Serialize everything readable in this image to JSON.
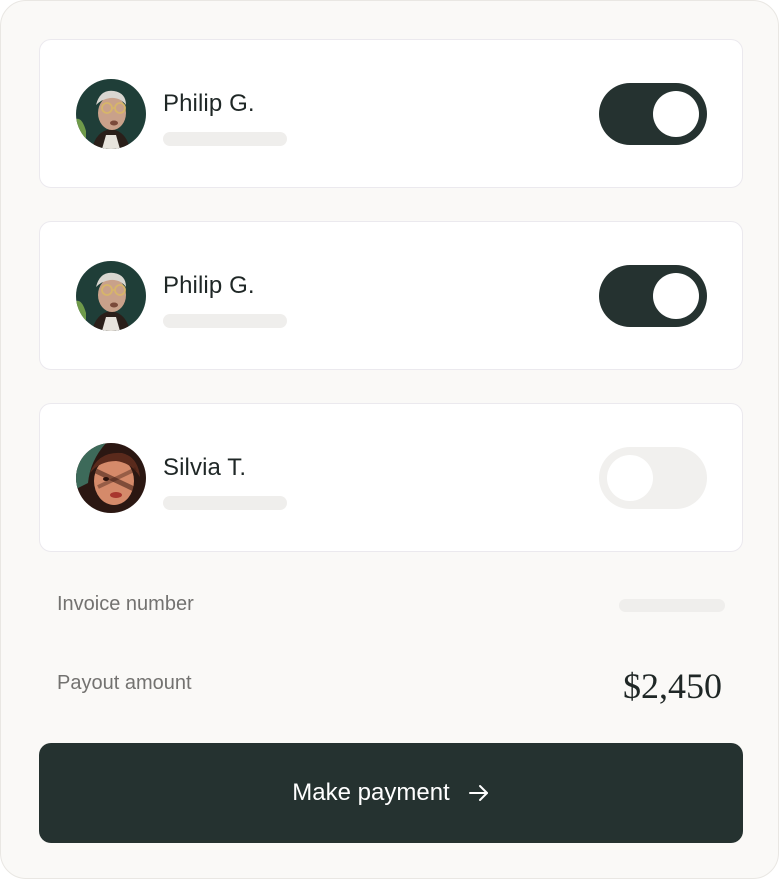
{
  "payees": [
    {
      "name": "Philip G.",
      "toggle_on": true,
      "avatar": "man-glasses-avatar"
    },
    {
      "name": "Philip G.",
      "toggle_on": true,
      "avatar": "man-glasses-avatar"
    },
    {
      "name": "Silvia T.",
      "toggle_on": false,
      "avatar": "woman-portrait-avatar"
    }
  ],
  "details": {
    "invoice_label": "Invoice number",
    "payout_label": "Payout amount",
    "payout_value": "$2,450"
  },
  "action": {
    "label": "Make payment",
    "icon": "arrow-right-icon"
  },
  "colors": {
    "accent": "#253230",
    "background": "#faf9f7",
    "card": "#ffffff",
    "skeleton": "#efeeec"
  }
}
